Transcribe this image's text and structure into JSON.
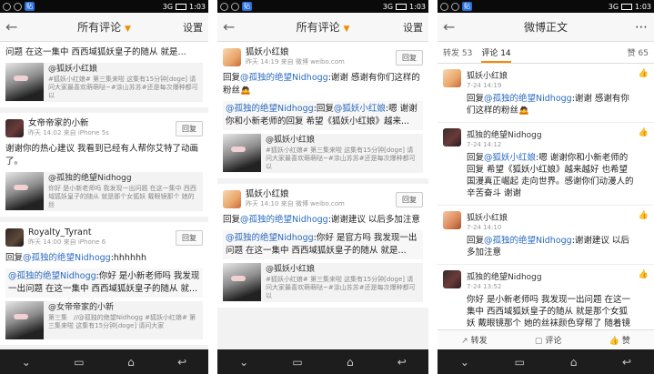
{
  "status": {
    "time": "1:03",
    "net": "3G",
    "badge": "贴"
  },
  "screen1": {
    "title": "所有评论",
    "settings": "设置",
    "cards": [
      {
        "text": "问题 在这一集中 西西域狐妖皇子的随从 就是...",
        "quote_name": "@狐妖小红娘",
        "quote_text": "#狐妖小红娘# 第三集来啦 这集有15分钟[doge] 请问大家最喜欢萌萌哒~#涂山苏苏#还是每次爆种都可以"
      },
      {
        "user": "女帝帝家的小新",
        "meta": "昨天 14:02  来自 iPhone 5s",
        "reply": "回复",
        "text": "谢谢你的热心建议 我看到已经有人帮你艾特了动画了。",
        "quote_name": "@孤独的绝望Nidhogg",
        "quote_text": "你好 是小新老师吗 我发现一出问题 在这一集中 西西域狐妖皇子的随从 就是那个女狐妖 戴眼镜那个 她的丝"
      },
      {
        "user": "Royalty_Tyrant",
        "meta": "昨天 14:00  来自 iPhone 6",
        "reply": "回复",
        "text_prefix": "回复",
        "text_mention": "@孤独的绝望Nidhogg",
        "text_rest": ":hhhhhh",
        "text2_mention": "@孤独的绝望Nidhogg",
        "text2_rest": ":你好 是小新老师吗 我发现一出问题 在这一集中 西西域狐妖皇子的随从 就...",
        "quote_name": "@女帝帝家的小新",
        "quote_text": "第三集　//@孤独的绝望Nidhogg #狐妖小红娘# 第三集来啦 这集有15分钟[doge] 请问大家"
      }
    ]
  },
  "screen2": {
    "title": "所有评论",
    "settings": "设置",
    "cards": [
      {
        "user": "狐妖小红娘",
        "meta": "昨天 14:19  来自 微博 weibo.com",
        "reply": "回复",
        "text_prefix": "回复",
        "text_mention": "@孤独的绝望Nidhogg",
        "text_rest": ":谢谢 感谢有你们这样的粉丝🙇",
        "text2_mention1": "@孤独的绝望Nidhogg",
        "text2_mid": ":回复",
        "text2_mention2": "@狐妖小红娘",
        "text2_rest": ":嗯 谢谢你和小新老师的回复 希望《狐妖小红娘》越来...",
        "quote_name": "@狐妖小红娘",
        "quote_text": "#狐妖小红娘# 第三集来啦 这集有15分钟[doge] 请问大家最喜欢萌萌哒~#涂山苏苏#还是每次爆种都可以"
      },
      {
        "user": "狐妖小红娘",
        "meta": "昨天 14:10  来自 微博 weibo.com",
        "reply": "回复",
        "text_prefix": "回复",
        "text_mention": "@孤独的绝望Nidhogg",
        "text_rest": ":谢谢建议 以后多加注意",
        "text2_mention": "@孤独的绝望Nidhogg",
        "text2_rest": ":你好 是官方吗 我发现一出问题 在这一集中 西西域狐妖皇子的随从 就是...",
        "quote_name": "@狐妖小红娘",
        "quote_text": "#狐妖小红娘# 第三集来啦 这集有15分钟[doge] 请问大家最喜欢萌萌哒~#涂山苏苏#还是每次爆种都可以"
      }
    ]
  },
  "screen3": {
    "title": "微博正文",
    "tabs": {
      "forward": "转发 53",
      "comment": "评论 14",
      "likes": "赞 65"
    },
    "comments": [
      {
        "user": "狐妖小红娘",
        "time": "7-24 14:19",
        "text_prefix": "回复",
        "mention": "@孤独的绝望Nidhogg",
        "rest": ":谢谢 感谢有你们这样的粉丝🙇"
      },
      {
        "user": "孤独的绝望Nidhogg",
        "time": "7-24 14:12",
        "text_prefix": "回复",
        "mention": "@狐妖小红娘",
        "rest": ":嗯 谢谢你和小新老师的回复 希望《狐妖小红娘》越来越好 也希望国漫真正崛起 走向世界。感谢你们动漫人的辛苦奋斗 谢谢"
      },
      {
        "user": "狐妖小红娘",
        "time": "7-24 14:10",
        "text_prefix": "回复",
        "mention": "@孤独的绝望Nidhogg",
        "rest": ":谢谢建议 以后多加注意"
      },
      {
        "user": "孤独的绝望Nidhogg",
        "time": "7-24 13:52",
        "text_prefix": "",
        "mention": "",
        "rest": "你好 是小新老师吗 我发现一出问题 在这一集中 西西域狐妖皇子的随从 就是那个女狐妖 戴眼镜那个 她的丝袜颜色穿帮了 随着镜头从黑色变成"
      }
    ],
    "actions": {
      "forward": "转发",
      "comment": "评论",
      "like": "赞"
    }
  }
}
